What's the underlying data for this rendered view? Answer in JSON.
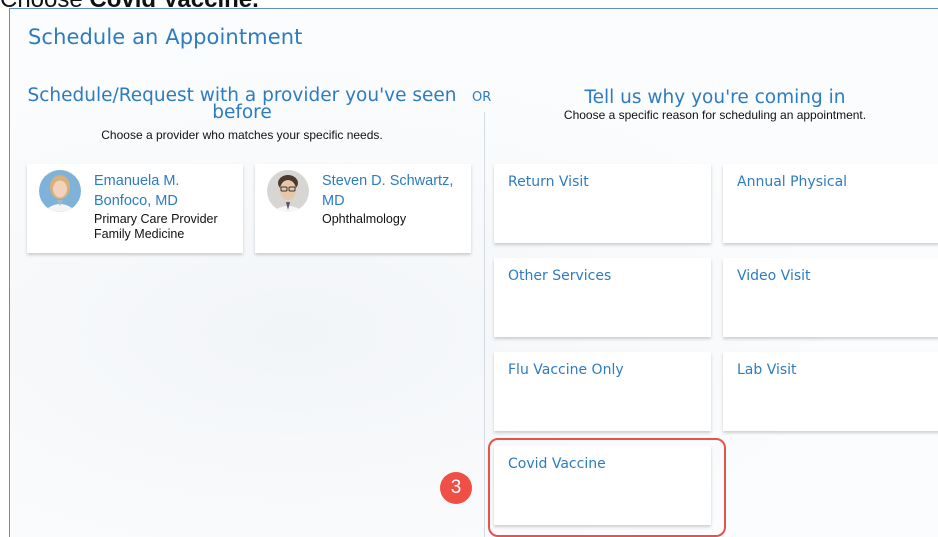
{
  "caption": {
    "prefix": "Choose ",
    "bold": "Covid Vaccine."
  },
  "page_title": "Schedule an Appointment",
  "left": {
    "heading": "Schedule/Request with a provider you've seen before",
    "subheading": "Choose a provider who matches your specific needs.",
    "providers": [
      {
        "name": "Emanuela M.\nBonfoco, MD",
        "role": "Primary Care Provider",
        "specialty": "Family Medicine",
        "avatar_icon": "provider-photo-icon"
      },
      {
        "name": "Steven D. Schwartz,\nMD",
        "role": "Ophthalmology",
        "avatar_icon": "provider-photo-icon"
      }
    ]
  },
  "or_label": "OR",
  "right": {
    "heading": "Tell us why you're coming in",
    "subheading": "Choose a specific reason for scheduling an appointment.",
    "reasons": [
      "Return Visit",
      "Annual Physical",
      "Other Services",
      "Video Visit",
      "Flu Vaccine Only",
      "Lab Visit",
      "Covid Vaccine"
    ]
  },
  "annotation": {
    "step_number": "3",
    "highlight_color": "#e8524a"
  },
  "colors": {
    "accent": "#2d7bc1",
    "frame_border": "#5b8fc7",
    "badge": "#ef4f45"
  }
}
